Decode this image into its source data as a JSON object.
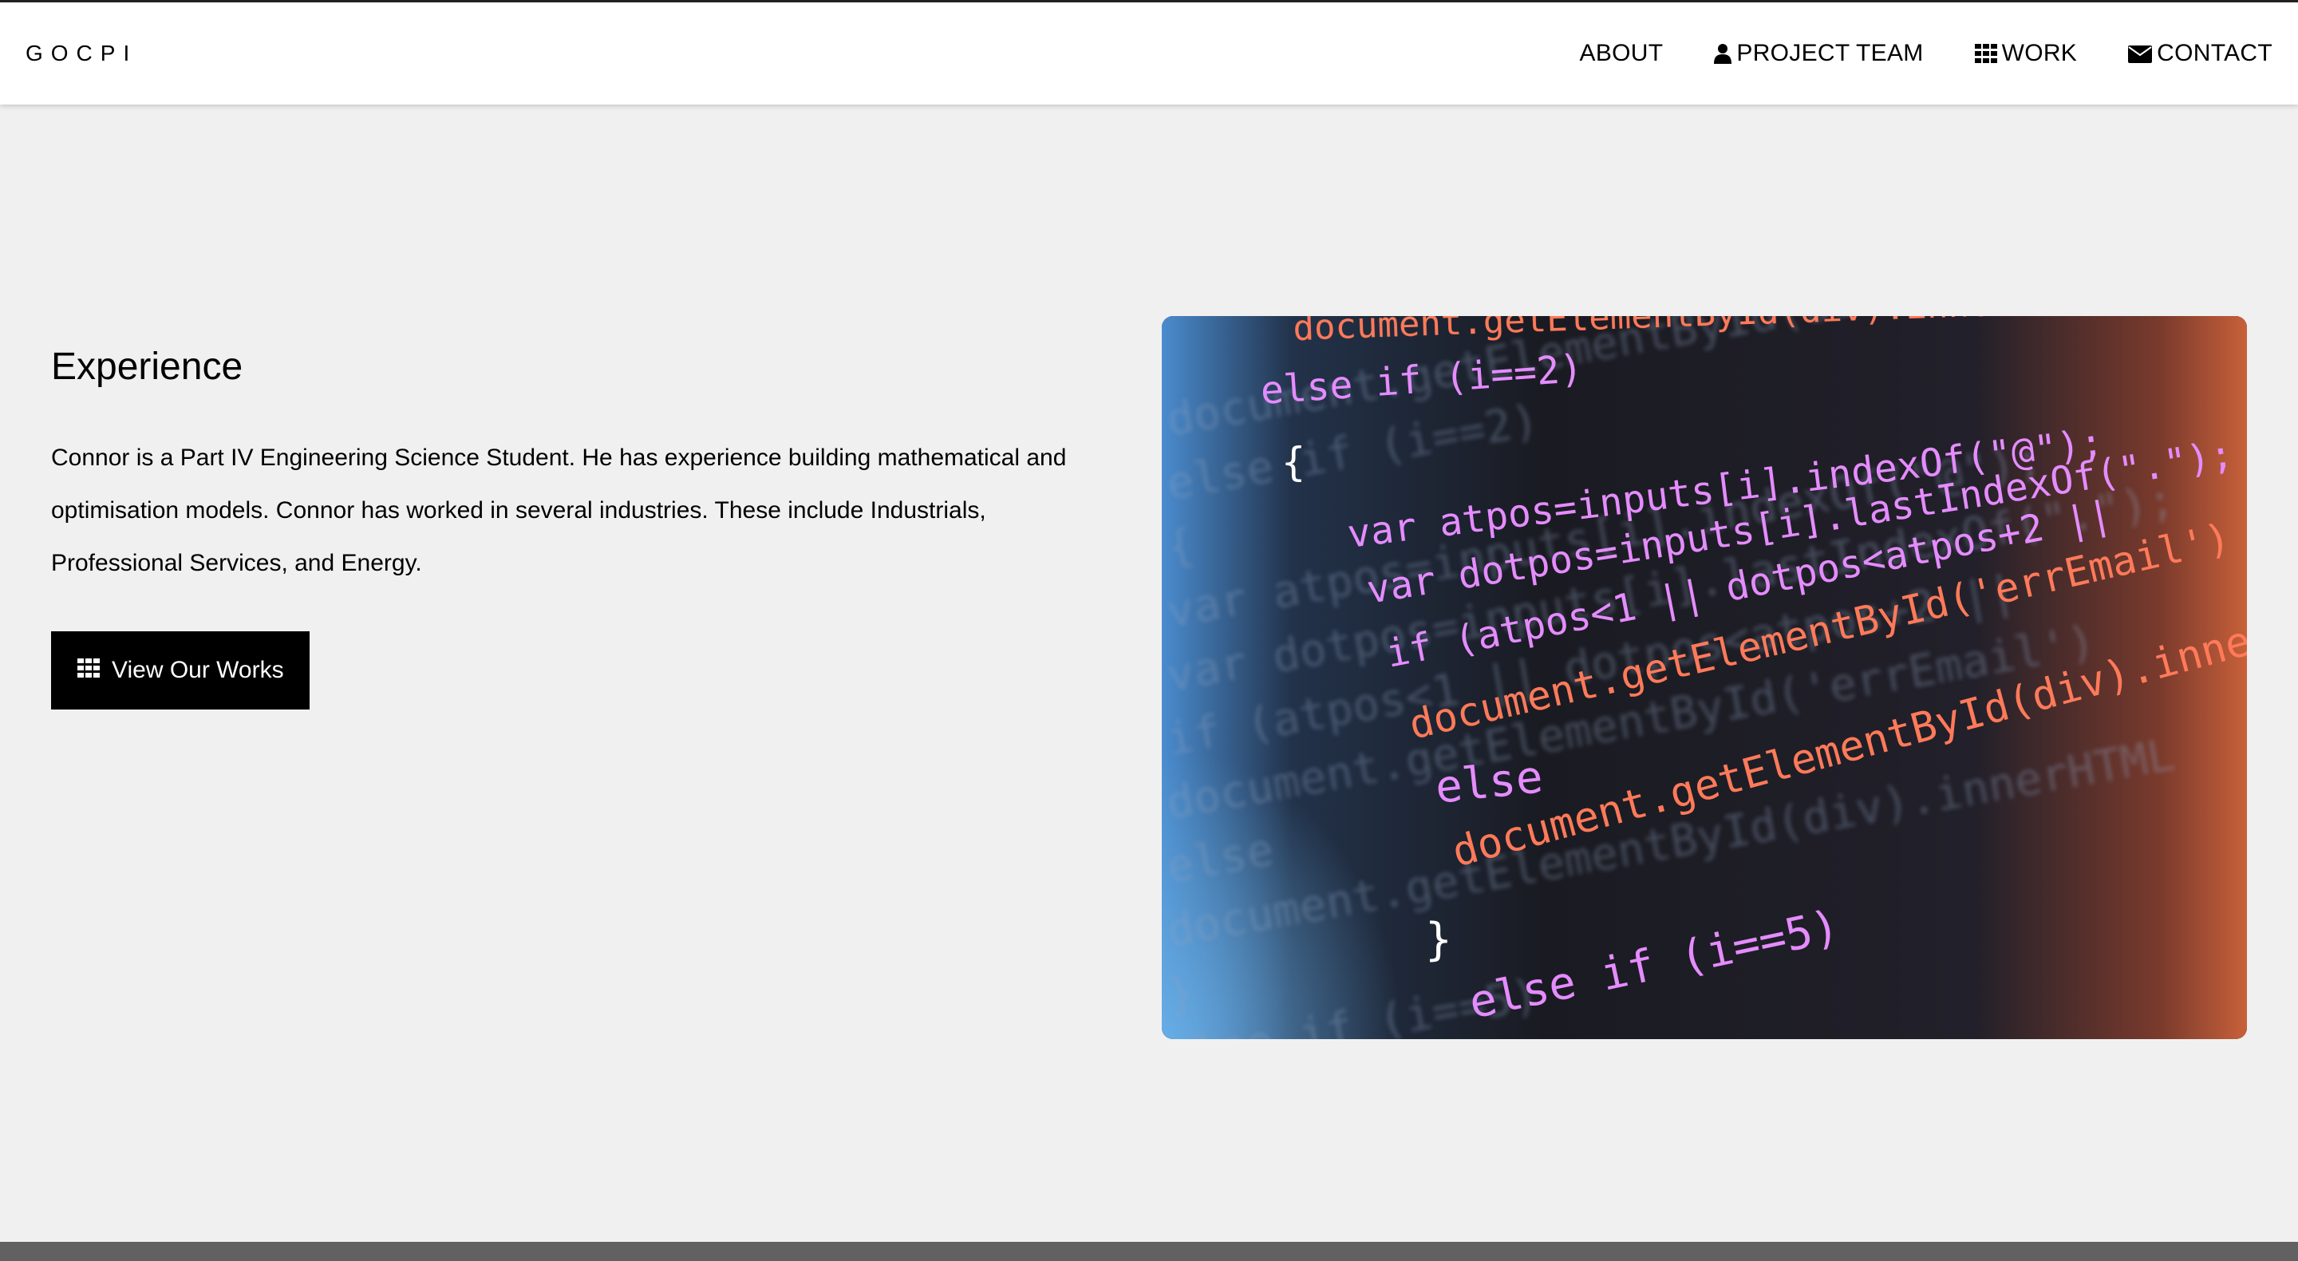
{
  "navbar": {
    "brand": "GOCPI",
    "items": [
      {
        "label": "ABOUT",
        "icon": null
      },
      {
        "label": "PROJECT TEAM",
        "icon": "user-icon"
      },
      {
        "label": "WORK",
        "icon": "grid-icon"
      },
      {
        "label": "CONTACT",
        "icon": "envelope-icon"
      }
    ]
  },
  "section": {
    "title": "Experience",
    "body": "Connor is a Part IV Engineering Science Student. He has experience building mathematical and optimisation models. Connor has worked in several industries. These include Industrials, Professional Services, and Energy.",
    "button_label": "View Our Works",
    "button_icon": "grid-icon"
  },
  "image": {
    "code_lines": [
      {
        "text": "document.getElementById(div).innerHTML = errMsg",
        "color": "#ff7a59"
      },
      {
        "text": "else if (i==2)",
        "color": "#e58cff"
      },
      {
        "text": "{",
        "color": "#ffffff"
      },
      {
        "text": "var atpos=inputs[i].indexOf(\"@\");",
        "color": "#e58cff"
      },
      {
        "text": "var dotpos=inputs[i].lastIndexOf(\".\");",
        "color": "#e58cff"
      },
      {
        "text": "if (atpos<1 || dotpos<atpos+2 ||",
        "color": "#e58cff"
      },
      {
        "text": "document.getElementById('errEmail')",
        "color": "#ff7a59"
      },
      {
        "text": "else",
        "color": "#e58cff"
      },
      {
        "text": "document.getElementById(div).innerHTML",
        "color": "#ff7a59"
      },
      {
        "text": "}",
        "color": "#ffffff"
      },
      {
        "text": "else if (i==5)",
        "color": "#e58cff"
      }
    ]
  },
  "colors": {
    "navbar_bg": "#ffffff",
    "page_bg": "#f0f0f0",
    "button_bg": "#000000",
    "button_text": "#ffffff",
    "footer_bg": "#616161"
  }
}
